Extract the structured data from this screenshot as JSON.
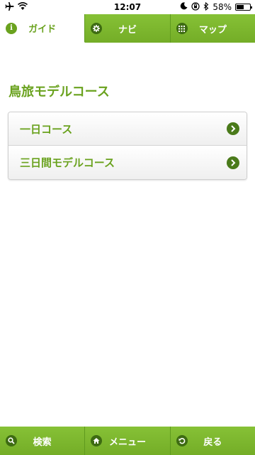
{
  "status_bar": {
    "time": "12:07",
    "battery_percent": "58%",
    "battery_level": 0.58,
    "icons": [
      "airplane-icon",
      "wifi-icon",
      "moon-icon",
      "rotation-lock-icon",
      "bluetooth-icon"
    ]
  },
  "top_tabs": [
    {
      "label": "ガイド",
      "icon": "info-icon",
      "active": true
    },
    {
      "label": "ナビ",
      "icon": "gear-icon",
      "active": false
    },
    {
      "label": "マップ",
      "icon": "grid-icon",
      "active": false
    }
  ],
  "main": {
    "title": "鳥旅モデルコース",
    "items": [
      {
        "label": "一日コース",
        "icon": "chevron-right-icon"
      },
      {
        "label": "三日間モデルコース",
        "icon": "chevron-right-icon"
      }
    ]
  },
  "bottom_bar": [
    {
      "label": "検索",
      "icon": "search-icon"
    },
    {
      "label": "メニュー",
      "icon": "home-icon"
    },
    {
      "label": "戻る",
      "icon": "back-icon"
    }
  ],
  "colors": {
    "accent": "#7cb82f",
    "text_accent": "#6aa21e",
    "icon_dark": "#3d6b12"
  }
}
